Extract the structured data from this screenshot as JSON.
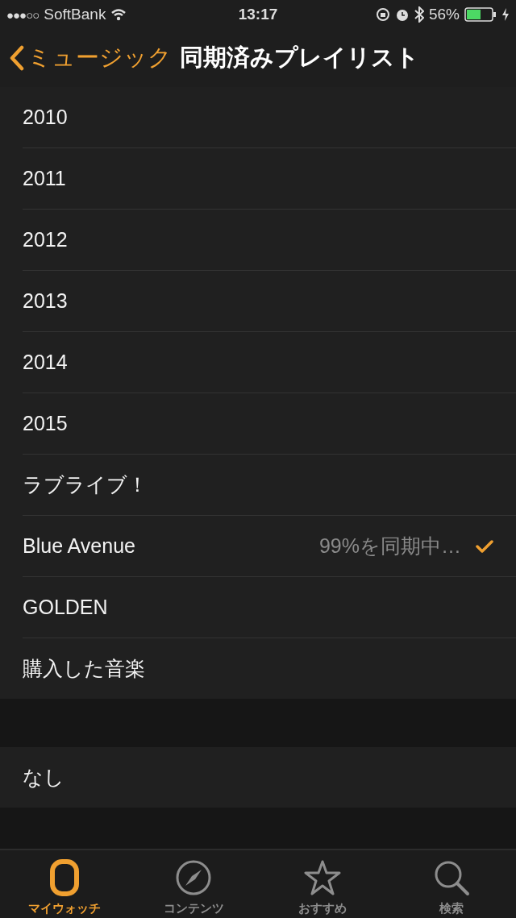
{
  "status_bar": {
    "signal_dots": "●●●○○",
    "carrier": "SoftBank",
    "time": "13:17",
    "battery": "56%"
  },
  "nav": {
    "back": "ミュージック",
    "title": "同期済みプレイリスト"
  },
  "playlists": [
    {
      "name": "2010",
      "checked": false
    },
    {
      "name": "2011",
      "checked": false
    },
    {
      "name": "2012",
      "checked": false
    },
    {
      "name": "2013",
      "checked": false
    },
    {
      "name": "2014",
      "checked": false
    },
    {
      "name": "2015",
      "checked": false
    },
    {
      "name": "ラブライブ！",
      "checked": false
    },
    {
      "name": "Blue Avenue",
      "status": "99%を同期中…",
      "checked": true
    },
    {
      "name": "GOLDEN",
      "checked": false
    },
    {
      "name": "購入した音楽",
      "checked": false
    }
  ],
  "other": [
    {
      "name": "なし",
      "checked": false
    }
  ],
  "tabs": [
    {
      "label": "マイウォッチ",
      "kind": "watch",
      "selected": true
    },
    {
      "label": "コンテンツ",
      "kind": "compass",
      "selected": false
    },
    {
      "label": "おすすめ",
      "kind": "star",
      "selected": false
    },
    {
      "label": "検索",
      "kind": "search",
      "selected": false
    }
  ]
}
